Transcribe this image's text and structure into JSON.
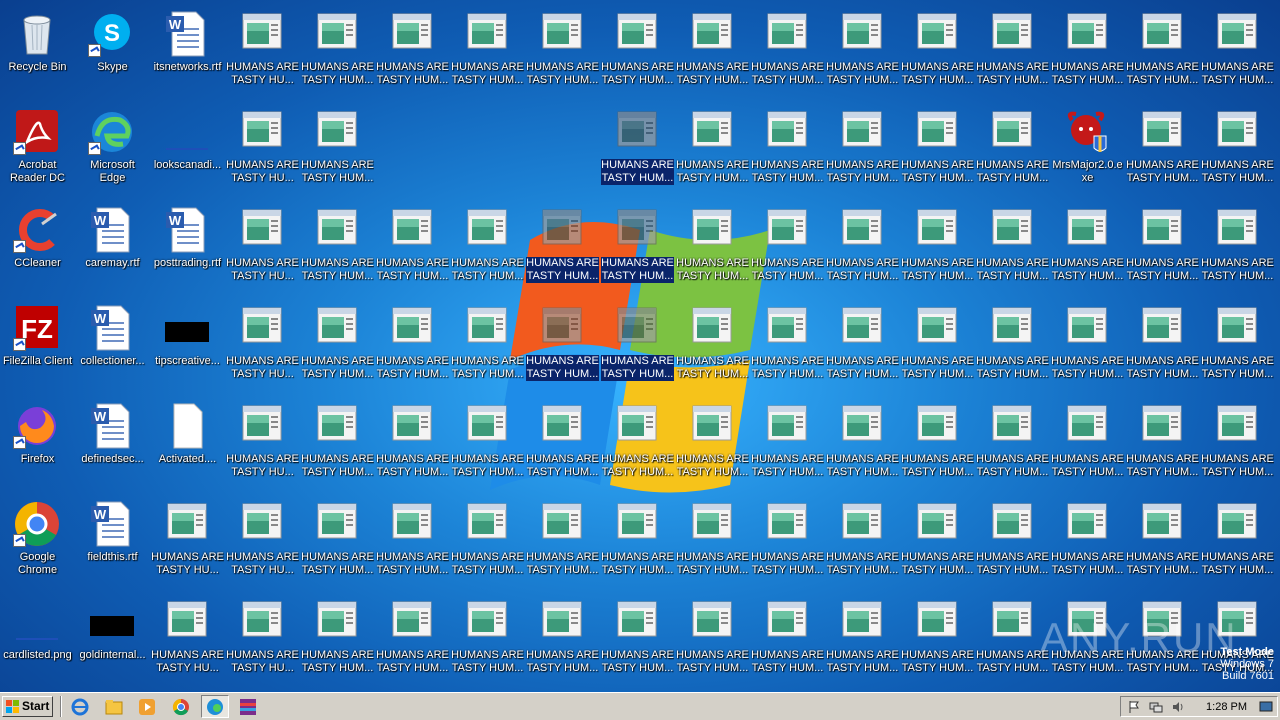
{
  "desktop": {
    "left_column": [
      {
        "label": "Recycle Bin",
        "kind": "recycle-bin",
        "shortcut": false
      },
      {
        "label": "Acrobat Reader DC",
        "kind": "acrobat",
        "shortcut": true
      },
      {
        "label": "CCleaner",
        "kind": "ccleaner",
        "shortcut": true
      },
      {
        "label": "FileZilla Client",
        "kind": "filezilla",
        "shortcut": true
      },
      {
        "label": "Firefox",
        "kind": "firefox",
        "shortcut": true
      },
      {
        "label": "Google Chrome",
        "kind": "chrome",
        "shortcut": true
      },
      {
        "label": "cardlisted.png",
        "kind": "png-blank",
        "shortcut": false
      }
    ],
    "second_column": [
      {
        "label": "Skype",
        "kind": "skype",
        "shortcut": true
      },
      {
        "label": "Microsoft Edge",
        "kind": "edge",
        "shortcut": true
      },
      {
        "label": "caremay.rtf",
        "kind": "word",
        "shortcut": false
      },
      {
        "label": "collectioner...",
        "kind": "word",
        "shortcut": false
      },
      {
        "label": "definedsec...",
        "kind": "word",
        "shortcut": false
      },
      {
        "label": "fieldthis.rtf",
        "kind": "word",
        "shortcut": false
      },
      {
        "label": "goldinternal...",
        "kind": "black",
        "shortcut": false
      }
    ],
    "third_column": [
      {
        "label": "itsnetworks.rtf",
        "kind": "word",
        "shortcut": false
      },
      {
        "label": "lookscanadi...",
        "kind": "png-blank",
        "shortcut": false
      },
      {
        "label": "posttrading.rtf",
        "kind": "word",
        "shortcut": false
      },
      {
        "label": "tipscreative...",
        "kind": "black",
        "shortcut": false
      },
      {
        "label": "Activated....",
        "kind": "blank",
        "shortcut": false
      },
      {
        "label": "HUMANS ARE TASTY HU...",
        "kind": "app",
        "shortcut": false
      },
      {
        "label": "HUMANS ARE TASTY HU...",
        "kind": "app",
        "shortcut": false
      }
    ],
    "humans_label": "HUMANS ARE TASTY HUM...",
    "humans_label_short": "HUMANS ARE TASTY HU...",
    "mrsmajor_label": "MrsMajor2.0.exe"
  },
  "taskbar": {
    "start_label": "Start",
    "clock": "1:28 PM",
    "quicklaunch": [
      "ie-icon",
      "explorer-icon",
      "media-player-icon",
      "chrome-icon",
      "edge-icon",
      "winrar-icon"
    ]
  },
  "watermark": {
    "line1": "Test Mode",
    "line2": "Windows 7",
    "line3": "Build 7601",
    "brand": "ANY.RUN"
  },
  "colors": {
    "desktop_bg": "#1c83d6",
    "selection": "#0a246a",
    "taskbar": "#d4d0c8"
  }
}
